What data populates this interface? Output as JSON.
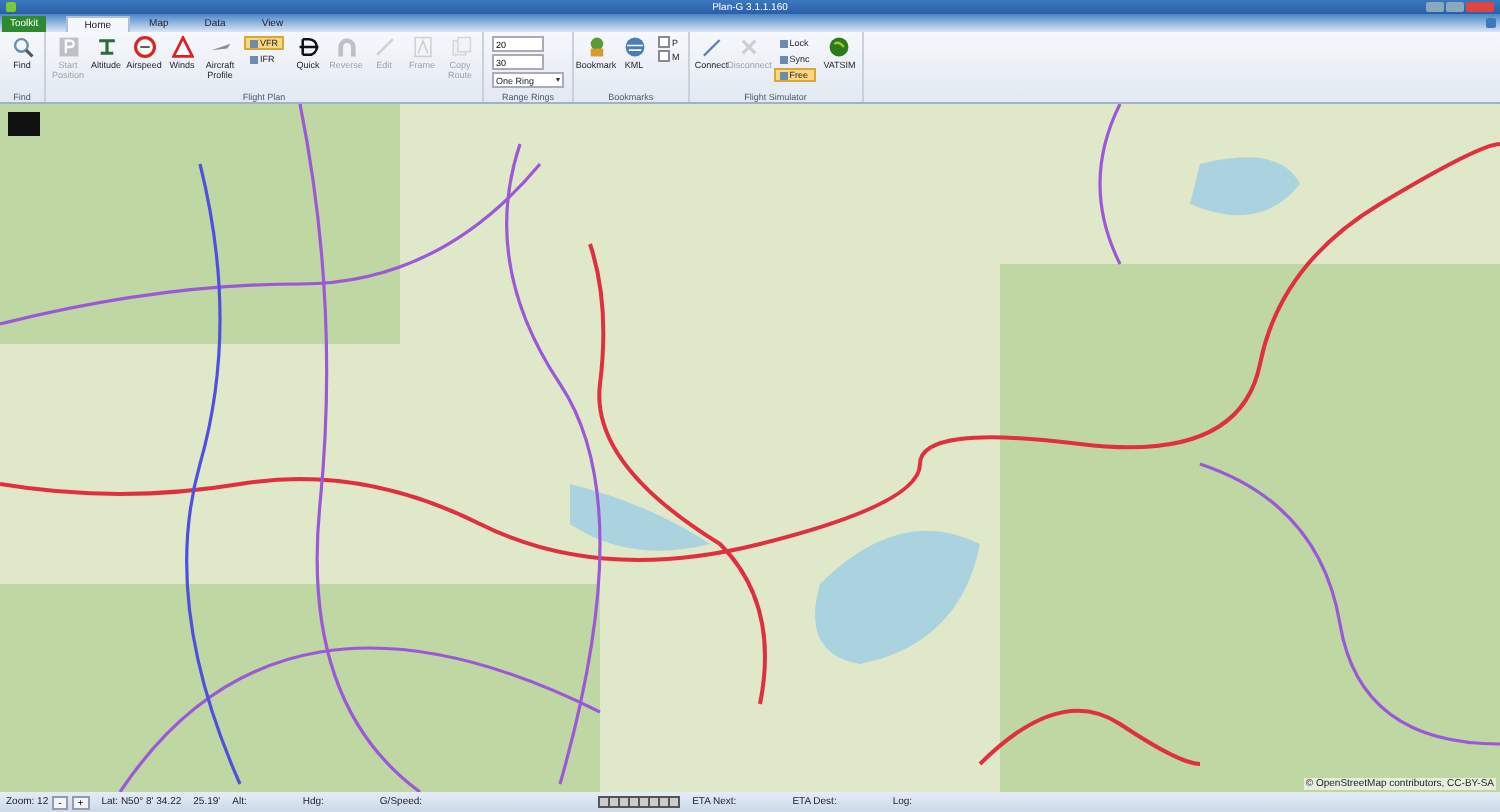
{
  "window": {
    "title": "Plan-G 3.1.1.160"
  },
  "app_button": {
    "label": "Toolkit"
  },
  "tabs": [
    {
      "label": "Home",
      "selected": true
    },
    {
      "label": "Map",
      "selected": false
    },
    {
      "label": "Data",
      "selected": false
    },
    {
      "label": "View",
      "selected": false
    }
  ],
  "ribbon_groups": [
    {
      "title": "Find",
      "items": [
        {
          "kind": "large",
          "label": "Find",
          "disabled": false
        }
      ]
    },
    {
      "title": "Flight Plan",
      "items": [
        {
          "kind": "large",
          "label": "Start Position",
          "disabled": true
        },
        {
          "kind": "large",
          "label": "Altitude",
          "disabled": false
        },
        {
          "kind": "large",
          "label": "Airspeed",
          "disabled": false
        },
        {
          "kind": "large",
          "label": "Winds",
          "disabled": false
        },
        {
          "kind": "large",
          "label": "Aircraft Profile",
          "disabled": false
        },
        {
          "kind": "stack",
          "items": [
            {
              "kind": "toggle",
              "label": "VFR",
              "selected": true
            },
            {
              "kind": "toggle",
              "label": "IFR",
              "selected": false
            }
          ]
        },
        {
          "kind": "large",
          "label": "Quick",
          "disabled": false
        },
        {
          "kind": "large",
          "label": "Reverse",
          "disabled": true
        },
        {
          "kind": "large",
          "label": "Edit",
          "disabled": true
        },
        {
          "kind": "large",
          "label": "Frame",
          "disabled": true
        },
        {
          "kind": "large",
          "label": "Copy Route",
          "disabled": true
        }
      ]
    },
    {
      "title": "Range Rings",
      "items": [
        {
          "kind": "stack",
          "items": [
            {
              "kind": "field",
              "value": "20"
            },
            {
              "kind": "field",
              "value": "30"
            },
            {
              "kind": "dropdown",
              "value": "One Ring"
            }
          ]
        }
      ]
    },
    {
      "title": "Bookmarks",
      "items": [
        {
          "kind": "large",
          "label": "Bookmark",
          "disabled": false
        },
        {
          "kind": "large",
          "label": "KML",
          "disabled": false
        },
        {
          "kind": "stack",
          "items": [
            {
              "kind": "checkbox",
              "label": "P",
              "checked": false
            },
            {
              "kind": "checkbox",
              "label": "M",
              "checked": false
            }
          ]
        }
      ]
    },
    {
      "title": "Flight Simulator",
      "items": [
        {
          "kind": "large",
          "label": "Connect",
          "disabled": false
        },
        {
          "kind": "large",
          "label": "Disconnect",
          "disabled": true
        },
        {
          "kind": "stack",
          "items": [
            {
              "kind": "toggle",
              "label": "Lock",
              "selected": false
            },
            {
              "kind": "toggle",
              "label": "Sync",
              "selected": false
            },
            {
              "kind": "toggle",
              "label": "Free",
              "selected": true
            }
          ]
        },
        {
          "kind": "large",
          "label": "VATSIM",
          "disabled": false
        }
      ]
    }
  ],
  "map": {
    "attribution": "© OpenStreetMap contributors, CC-BY-SA"
  },
  "status_bar": [
    {
      "kind": "text",
      "text": "Zoom: 12"
    },
    {
      "kind": "button",
      "text": "-"
    },
    {
      "kind": "button",
      "text": "+"
    },
    {
      "kind": "text",
      "text": "Lat: N50° 8' 34.22"
    },
    {
      "kind": "text",
      "text": "25.19'"
    },
    {
      "kind": "text",
      "text": "Alt:"
    },
    {
      "kind": "text",
      "text": "Hdg:"
    },
    {
      "kind": "text",
      "text": "G/Speed:"
    },
    {
      "kind": "meter"
    },
    {
      "kind": "text",
      "text": "ETA Next:"
    },
    {
      "kind": "text",
      "text": "ETA Dest:"
    },
    {
      "kind": "text",
      "text": "Log:"
    }
  ]
}
